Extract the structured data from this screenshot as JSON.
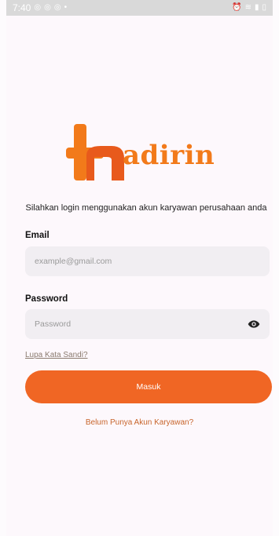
{
  "status_bar": {
    "time": "7:40",
    "left_icons": [
      "instagram-icon",
      "instagram-icon",
      "instagram-icon",
      "dot-icon"
    ],
    "right_icons": [
      "alarm-icon",
      "wifi-icon",
      "signal-icon",
      "battery-icon"
    ]
  },
  "brand": {
    "logo_text": "adirin",
    "color": "#f27a1a"
  },
  "subtitle": "Silahkan login menggunakan akun karyawan perusahaan anda",
  "email": {
    "label": "Email",
    "placeholder": "example@gmail.com",
    "value": ""
  },
  "password": {
    "label": "Password",
    "placeholder": "Password",
    "value": ""
  },
  "forgot_label": "Lupa Kata Sandi?",
  "login_label": "Masuk",
  "register_label": "Belum Punya Akun Karyawan?",
  "colors": {
    "accent": "#f06624",
    "input_bg": "#f1eef2"
  }
}
